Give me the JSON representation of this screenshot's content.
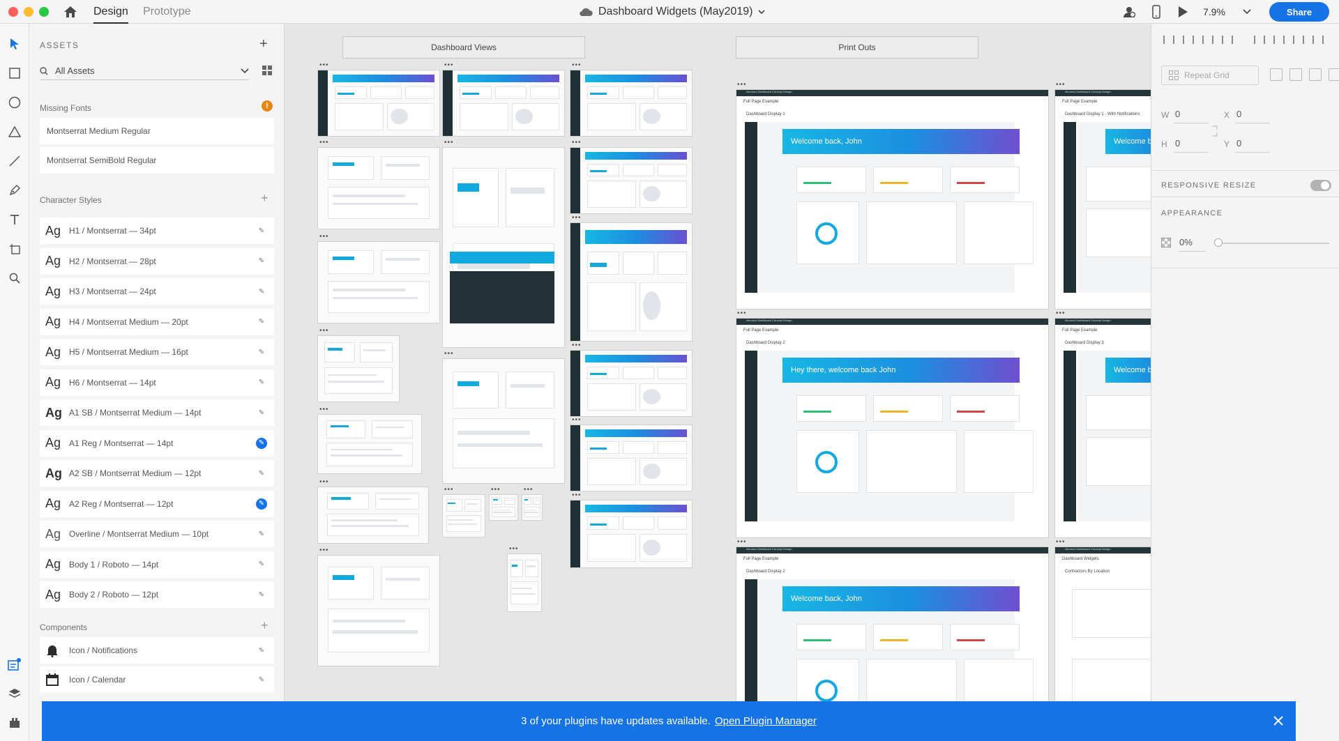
{
  "titlebar": {
    "mode_design": "Design",
    "mode_prototype": "Prototype",
    "doc_title": "Dashboard Widgets (May2019)",
    "zoom": "7.9%",
    "share": "Share"
  },
  "assets": {
    "header": "ASSETS",
    "filter": "All Assets",
    "missing_fonts_label": "Missing Fonts",
    "missing_fonts": [
      "Montserrat Medium Regular",
      "Montserrat SemiBold Regular"
    ],
    "character_styles_label": "Character Styles",
    "character_styles": [
      {
        "ag": "Ag",
        "name": "H1 / Montserrat — 34pt"
      },
      {
        "ag": "Ag",
        "name": "H2 / Montserrat — 28pt"
      },
      {
        "ag": "Ag",
        "name": "H3 / Montserrat — 24pt"
      },
      {
        "ag": "Ag",
        "name": "H4 / Montserrat Medium — 20pt"
      },
      {
        "ag": "Ag",
        "name": "H5 / Montserrat Medium — 16pt"
      },
      {
        "ag": "Ag",
        "name": "H6 / Montserrat — 14pt"
      },
      {
        "ag": "Ag",
        "name": "A1 SB / Montserrat Medium — 14pt"
      },
      {
        "ag": "Ag",
        "name": "A1 Reg / Montserrat — 14pt"
      },
      {
        "ag": "Ag",
        "name": "A2 SB / Montserrat Medium — 12pt"
      },
      {
        "ag": "Ag",
        "name": "A2 Reg / Montserrat — 12pt"
      },
      {
        "ag": "Ag",
        "name": "Overline / Montserrat Medium — 10pt"
      },
      {
        "ag": "Ag",
        "name": "Body 1 / Roboto — 14pt"
      },
      {
        "ag": "Ag",
        "name": "Body 2 / Roboto — 12pt"
      }
    ],
    "components_label": "Components",
    "components": [
      {
        "icon": "bell-icon",
        "name": "Icon / Notifications"
      },
      {
        "icon": "calendar-icon",
        "name": "Icon / Calendar"
      }
    ]
  },
  "canvas": {
    "group_dashboard": "Dashboard Views",
    "group_print": "Print Outs",
    "print_top_text": "Alcumus Dashboard Concept Design",
    "print_full_page": "Full Page Example",
    "print_widgets": "Dashboard Widgets",
    "prints": [
      {
        "label": "Dashboard Display 1",
        "header": "Welcome back, John"
      },
      {
        "label": "Dashboard Display 1 - With Notifications",
        "header": "Welcome back"
      },
      {
        "label": "Dashboard Display 2",
        "header": "Hey there, welcome back John"
      },
      {
        "label": "Dashboard Display 3",
        "header": "Welcome b"
      },
      {
        "label": "Dashboard Display 2",
        "header": "Welcome back, John"
      },
      {
        "label": "Contractors By Location",
        "header": ""
      }
    ]
  },
  "props": {
    "repeat_grid": "Repeat Grid",
    "w_label": "W",
    "w_value": "0",
    "h_label": "H",
    "h_value": "0",
    "x_label": "X",
    "x_value": "0",
    "y_label": "Y",
    "y_value": "0",
    "responsive_resize": "RESPONSIVE RESIZE",
    "appearance": "APPEARANCE",
    "opacity": "0%"
  },
  "notification": {
    "text": "3 of your plugins have updates available.",
    "link": "Open Plugin Manager"
  },
  "colors": {
    "accent": "#1473e6",
    "warning": "#e68619",
    "gradient_start": "#17b7e3",
    "gradient_end": "#6a4fd1",
    "sidebar_dark": "#1f3134"
  }
}
